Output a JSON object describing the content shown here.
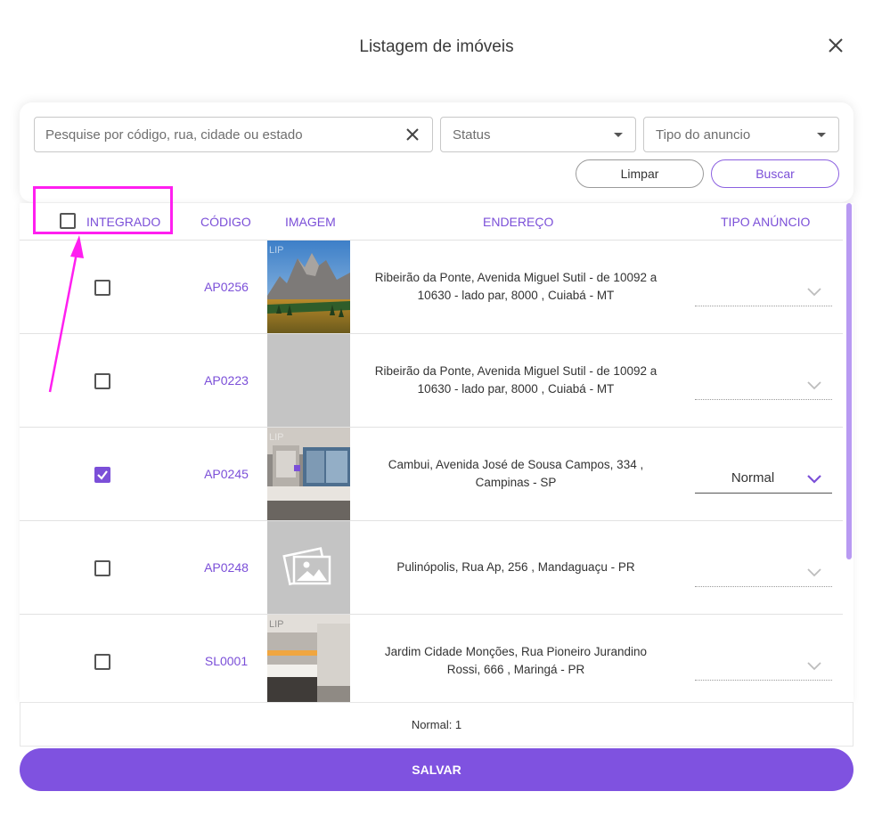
{
  "modal": {
    "title": "Listagem de imóveis"
  },
  "filters": {
    "search_placeholder": "Pesquise por código, rua, cidade ou estado",
    "status_placeholder": "Status",
    "tipo_placeholder": "Tipo do anuncio",
    "clear_label": "Limpar",
    "search_label": "Buscar"
  },
  "table": {
    "headers": {
      "integrado": "INTEGRADO",
      "codigo": "CÓDIGO",
      "imagem": "IMAGEM",
      "endereco": "ENDEREÇO",
      "tipo_anuncio": "TIPO ANÚNCIO"
    },
    "rows": [
      {
        "checked": false,
        "code": "AP0256",
        "image": "mountain-photo",
        "address_line1": "Ribeirão da Ponte, Avenida Miguel Sutil - de 10092 a",
        "address_line2": "10630 - lado par, 8000 , Cuiabá - MT",
        "tipo": ""
      },
      {
        "checked": false,
        "code": "AP0223",
        "image": "gray-placeholder",
        "address_line1": "Ribeirão da Ponte, Avenida Miguel Sutil - de 10092 a",
        "address_line2": "10630 - lado par, 8000 , Cuiabá - MT",
        "tipo": ""
      },
      {
        "checked": true,
        "code": "AP0245",
        "image": "bathroom-photo",
        "address_line1": "Cambui, Avenida José de Sousa Campos, 334 ,",
        "address_line2": "Campinas - SP",
        "tipo": "Normal"
      },
      {
        "checked": false,
        "code": "AP0248",
        "image": "no-image-icon",
        "address_line1": "Pulinópolis, Rua Ap, 256 , Mandaguaçu - PR",
        "address_line2": "",
        "tipo": ""
      },
      {
        "checked": false,
        "code": "SL0001",
        "image": "bathroom-photo-2",
        "address_line1": "Jardim Cidade Monções, Rua Pioneiro Jurandino",
        "address_line2": "Rossi, 666 , Maringá - PR",
        "tipo": ""
      }
    ]
  },
  "summary": {
    "text": "Normal: 1"
  },
  "footer": {
    "save_label": "SALVAR"
  },
  "colors": {
    "accent": "#7f52e0",
    "annotation": "#ff1ff0"
  }
}
